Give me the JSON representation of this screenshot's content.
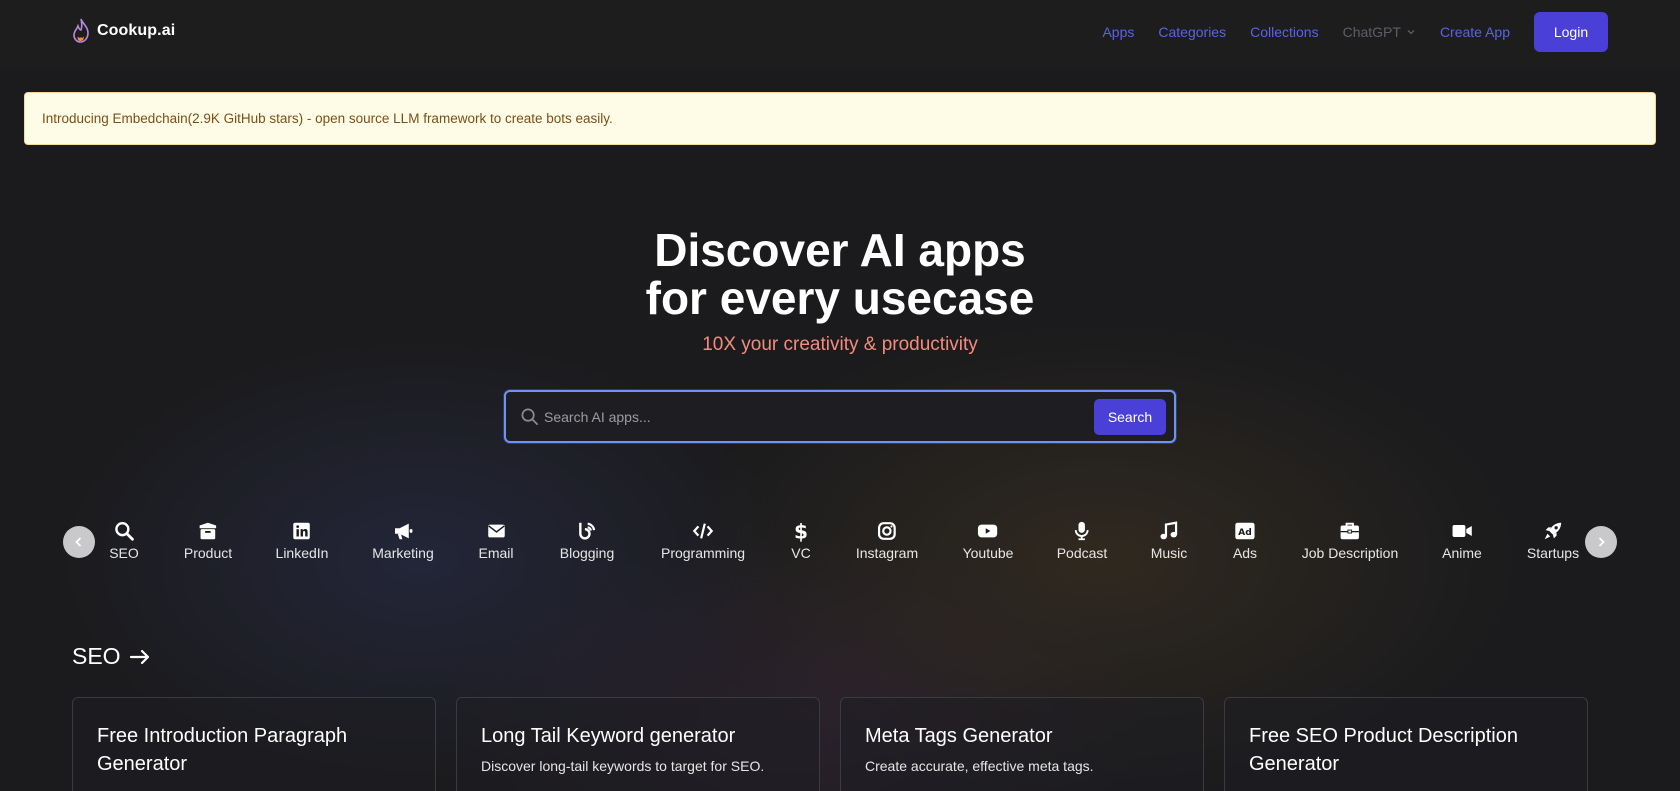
{
  "header": {
    "logo_text": "Cookup.ai",
    "nav": [
      {
        "label": "Apps"
      },
      {
        "label": "Categories"
      },
      {
        "label": "Collections"
      },
      {
        "label": "ChatGPT"
      },
      {
        "label": "Create App"
      }
    ],
    "login_label": "Login"
  },
  "banner": {
    "text": "Introducing Embedchain(2.9K GitHub stars) - open source LLM framework to create bots easily."
  },
  "hero": {
    "title_line1": "Discover AI apps",
    "title_line2": "for every usecase",
    "subtitle": "10X your creativity & productivity"
  },
  "search": {
    "placeholder": "Search AI apps...",
    "button_label": "Search"
  },
  "categories": [
    {
      "label": "SEO",
      "icon": "search-icon"
    },
    {
      "label": "Product",
      "icon": "box-icon"
    },
    {
      "label": "LinkedIn",
      "icon": "linkedin-icon"
    },
    {
      "label": "Marketing",
      "icon": "megaphone-icon"
    },
    {
      "label": "Email",
      "icon": "envelope-icon"
    },
    {
      "label": "Blogging",
      "icon": "blog-icon"
    },
    {
      "label": "Programming",
      "icon": "code-icon"
    },
    {
      "label": "VC",
      "icon": "dollar-icon"
    },
    {
      "label": "Instagram",
      "icon": "instagram-icon"
    },
    {
      "label": "Youtube",
      "icon": "youtube-icon"
    },
    {
      "label": "Podcast",
      "icon": "microphone-icon"
    },
    {
      "label": "Music",
      "icon": "music-icon"
    },
    {
      "label": "Ads",
      "icon": "ad-icon"
    },
    {
      "label": "Job Description",
      "icon": "briefcase-icon"
    },
    {
      "label": "Anime",
      "icon": "video-icon"
    },
    {
      "label": "Startups",
      "icon": "rocket-icon"
    }
  ],
  "section": {
    "title": "SEO"
  },
  "cards": [
    {
      "title": "Free Introduction Paragraph Generator",
      "desc": ""
    },
    {
      "title": "Long Tail Keyword generator",
      "desc": "Discover long-tail keywords to target for SEO."
    },
    {
      "title": "Meta Tags Generator",
      "desc": "Create accurate, effective meta tags."
    },
    {
      "title": "Free SEO Product Description Generator",
      "desc": ""
    }
  ],
  "colors": {
    "accent": "#4a3fd6",
    "nav_link": "#5a63e8",
    "subtitle": "#f28c7f",
    "banner_bg": "#fefbe7",
    "banner_text": "#7b5017"
  }
}
